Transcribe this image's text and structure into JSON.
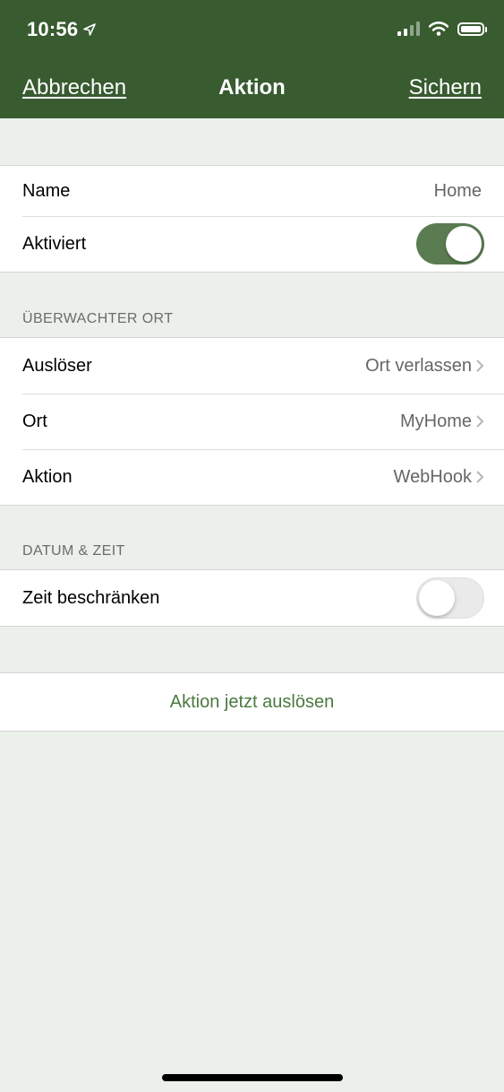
{
  "status_bar": {
    "time": "10:56"
  },
  "nav": {
    "cancel_label": "Abbrechen",
    "title": "Aktion",
    "save_label": "Sichern"
  },
  "general": {
    "name_label": "Name",
    "name_value": "Home",
    "enabled_label": "Aktiviert",
    "enabled": true
  },
  "location_section": {
    "header": "ÜBERWACHTER ORT",
    "rows": [
      {
        "label": "Auslöser",
        "value": "Ort verlassen"
      },
      {
        "label": "Ort",
        "value": "MyHome"
      },
      {
        "label": "Aktion",
        "value": "WebHook"
      }
    ]
  },
  "datetime_section": {
    "header": "DATUM & ZEIT",
    "limit_time_label": "Zeit beschränken",
    "limit_time_enabled": false
  },
  "trigger_button": {
    "label": "Aktion jetzt auslösen"
  },
  "colors": {
    "header_bg": "#385b30",
    "accent_green": "#4b7a40",
    "toggle_on": "#5b7c52",
    "page_bg": "#ecf0eb"
  }
}
